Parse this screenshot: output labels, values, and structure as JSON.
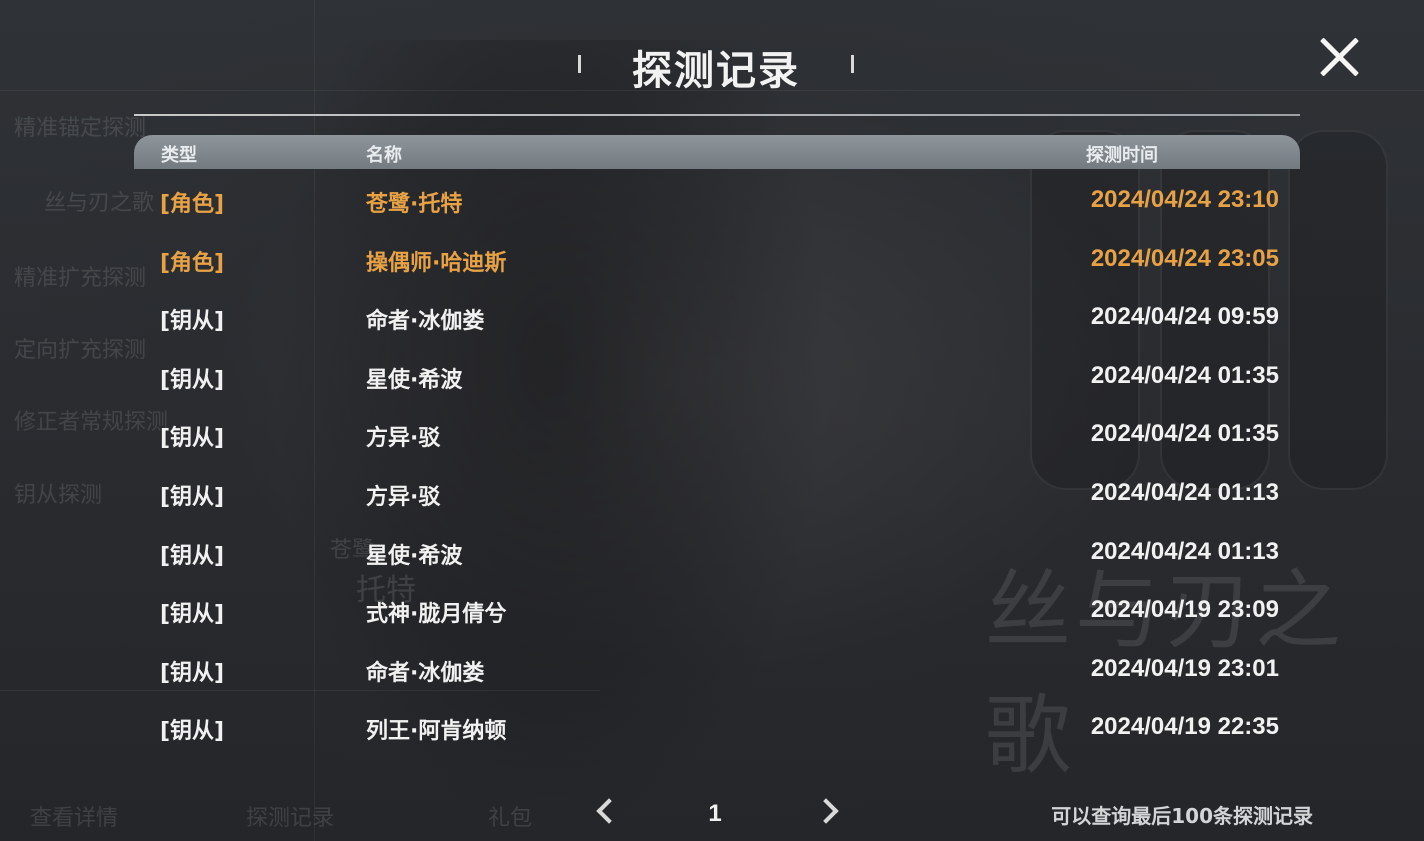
{
  "header": {
    "title": "探测记录"
  },
  "table": {
    "columns": {
      "type": "类型",
      "name": "名称",
      "time": "探测时间"
    },
    "rows": [
      {
        "type": "[角色]",
        "name": "苍鹭·托特",
        "time": "2024/04/24 23:10",
        "highlight": true
      },
      {
        "type": "[角色]",
        "name": "操偶师·哈迪斯",
        "time": "2024/04/24 23:05",
        "highlight": true
      },
      {
        "type": "[钥从]",
        "name": "命者·冰伽娄",
        "time": "2024/04/24 09:59",
        "highlight": false
      },
      {
        "type": "[钥从]",
        "name": "星使·希波",
        "time": "2024/04/24 01:35",
        "highlight": false
      },
      {
        "type": "[钥从]",
        "name": "方异·驳",
        "time": "2024/04/24 01:35",
        "highlight": false
      },
      {
        "type": "[钥从]",
        "name": "方异·驳",
        "time": "2024/04/24 01:13",
        "highlight": false
      },
      {
        "type": "[钥从]",
        "name": "星使·希波",
        "time": "2024/04/24 01:13",
        "highlight": false
      },
      {
        "type": "[钥从]",
        "name": "式神·胧月倩兮",
        "time": "2024/04/19 23:09",
        "highlight": false
      },
      {
        "type": "[钥从]",
        "name": "命者·冰伽娄",
        "time": "2024/04/19 23:01",
        "highlight": false
      },
      {
        "type": "[钥从]",
        "name": "列王·阿肯纳顿",
        "time": "2024/04/19 22:35",
        "highlight": false
      }
    ]
  },
  "pagination": {
    "current_page": "1"
  },
  "footer": {
    "note": "可以查询最后100条探测记录"
  },
  "background": {
    "ghost_texts": [
      "精准锚定探测",
      "丝与刃之歌",
      "精准扩充探测",
      "定向扩充探测",
      "修正者常规探测",
      "钥从探测",
      "查看详情",
      "探测记录",
      "礼包",
      "托特",
      "苍鹭"
    ]
  },
  "colors": {
    "highlight": "#e8a246",
    "text": "#f1f1f1",
    "header_bar": "#7f868c"
  },
  "icons": {
    "close": "close-icon",
    "prev": "chevron-left-icon",
    "next": "chevron-right-icon"
  }
}
